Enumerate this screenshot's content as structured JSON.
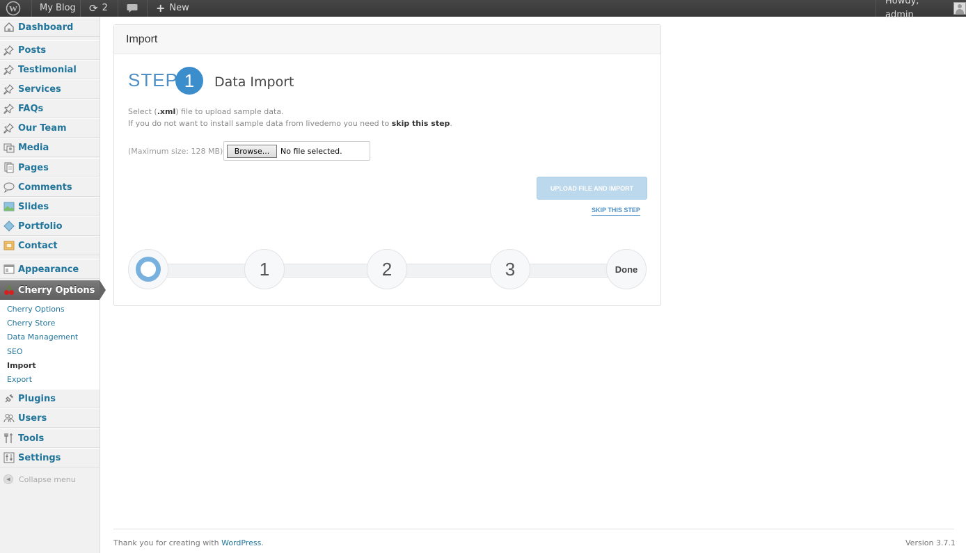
{
  "adminbar": {
    "site_name": "My Blog",
    "updates_count": "2",
    "new_label": "New",
    "greeting": "Howdy, admin"
  },
  "sidebar": {
    "items": [
      {
        "label": "Dashboard",
        "icon": "dashboard-icon"
      },
      {
        "label": "Posts",
        "icon": "pin-icon"
      },
      {
        "label": "Testimonial",
        "icon": "pin-icon"
      },
      {
        "label": "Services",
        "icon": "pin-icon"
      },
      {
        "label": "FAQs",
        "icon": "pin-icon"
      },
      {
        "label": "Our Team",
        "icon": "pin-icon"
      },
      {
        "label": "Media",
        "icon": "media-icon"
      },
      {
        "label": "Pages",
        "icon": "pages-icon"
      },
      {
        "label": "Comments",
        "icon": "comments-icon"
      },
      {
        "label": "Slides",
        "icon": "slides-icon"
      },
      {
        "label": "Portfolio",
        "icon": "portfolio-icon"
      },
      {
        "label": "Contact",
        "icon": "contact-icon"
      },
      {
        "label": "Appearance",
        "icon": "appearance-icon"
      },
      {
        "label": "Cherry Options",
        "icon": "cherry-icon"
      },
      {
        "label": "Plugins",
        "icon": "plugins-icon"
      },
      {
        "label": "Users",
        "icon": "users-icon"
      },
      {
        "label": "Tools",
        "icon": "tools-icon"
      },
      {
        "label": "Settings",
        "icon": "settings-icon"
      }
    ],
    "submenu": [
      {
        "label": "Cherry Options"
      },
      {
        "label": "Cherry Store"
      },
      {
        "label": "Data Management"
      },
      {
        "label": "SEO"
      },
      {
        "label": "Import"
      },
      {
        "label": "Export"
      }
    ],
    "collapse_label": "Collapse menu"
  },
  "panel": {
    "title": "Import",
    "step_word": "STEP",
    "step_number": "1",
    "step_title": "Data Import",
    "desc_line1_pre": "Select (",
    "desc_line1_bold": ".xml",
    "desc_line1_post": ") file to upload sample data.",
    "desc_line2_pre": "If you do not want to install sample data from livedemo you need to ",
    "desc_line2_bold": "skip this step",
    "desc_line2_post": ".",
    "max_size": "(Maximum size: 128 MB)",
    "browse_label": "Browse...",
    "no_file": "No file selected.",
    "upload_label": "UPLOAD FILE AND IMPORT",
    "skip_label": "SKIP THIS STEP",
    "progress_steps": [
      "1",
      "2",
      "3",
      "Done"
    ]
  },
  "footer": {
    "thanks_pre": "Thank you for creating with ",
    "thanks_link": "WordPress",
    "thanks_post": ".",
    "version": "Version 3.7.1"
  },
  "colors": {
    "accent": "#21759b",
    "step_blue": "#3b8dcc",
    "adminbar": "#464646"
  }
}
